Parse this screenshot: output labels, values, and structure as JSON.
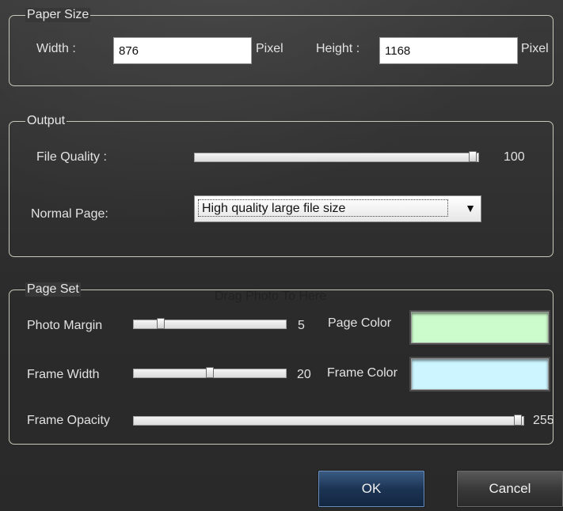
{
  "paper_size": {
    "legend": "Paper Size",
    "width_label": "Width :",
    "width_value": "876",
    "width_unit": "Pixel",
    "height_label": "Height :",
    "height_value": "1168",
    "height_unit": "Pixel"
  },
  "output": {
    "legend": "Output",
    "file_quality_label": "File Quality :",
    "file_quality_value": "100",
    "normal_page_label": "Normal Page:",
    "normal_page_selected": "High quality large file size"
  },
  "page_set": {
    "legend": "Page Set",
    "drop_hint": "Drag Photo To Here",
    "photo_margin_label": "Photo Margin",
    "photo_margin_value": "5",
    "frame_width_label": "Frame Width",
    "frame_width_value": "20",
    "frame_opacity_label": "Frame Opacity",
    "frame_opacity_value": "255",
    "page_color_label": "Page Color",
    "page_color": "#ccfccc",
    "frame_color_label": "Frame Color",
    "frame_color": "#ccf5ff"
  },
  "sliders": {
    "file_quality": 1.0,
    "photo_margin": 0.15,
    "frame_width": 0.5,
    "frame_opacity": 1.0
  },
  "buttons": {
    "ok_label": "OK",
    "cancel_label": "Cancel"
  },
  "colors": {
    "dialog_bg": "#2f2f2f",
    "ok_button": "#1c3454"
  }
}
